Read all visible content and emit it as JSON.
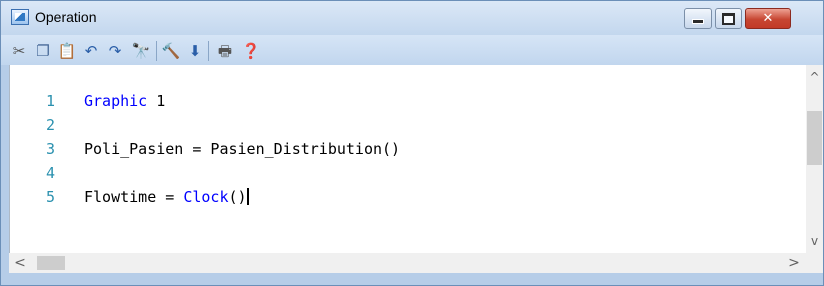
{
  "window": {
    "title": "Operation"
  },
  "title_buttons": {
    "close_glyph": "✕"
  },
  "toolbar": {
    "items": [
      {
        "name": "cut-icon",
        "glyph": "✂",
        "color": "#555555"
      },
      {
        "name": "copy-icon",
        "glyph": "❐",
        "color": "#4a6b99"
      },
      {
        "name": "paste-icon",
        "glyph": "📋",
        "color": "#b8862b"
      },
      {
        "name": "undo-icon",
        "glyph": "↶",
        "color": "#2a5ea8"
      },
      {
        "name": "redo-icon",
        "glyph": "↷",
        "color": "#2a5ea8"
      },
      {
        "name": "find-icon",
        "glyph": "🔭",
        "color": "#333333"
      },
      {
        "name": "build-icon",
        "glyph": "🔨",
        "color": "#6a4a2a"
      },
      {
        "name": "insert-icon",
        "glyph": "⬇",
        "color": "#2a5ea8"
      },
      {
        "name": "print-icon",
        "glyph": "🖶",
        "color": "#555555"
      },
      {
        "name": "help-icon",
        "glyph": "❓",
        "color": "#1f5fae"
      }
    ]
  },
  "editor": {
    "lines": [
      {
        "number": "1",
        "segments": [
          {
            "text": "Graphic",
            "kw": true
          },
          {
            "text": " 1",
            "kw": false
          }
        ]
      },
      {
        "number": "2",
        "segments": []
      },
      {
        "number": "3",
        "segments": [
          {
            "text": "Poli_Pasien = Pasien_Distribution()",
            "kw": false
          }
        ]
      },
      {
        "number": "4",
        "segments": []
      },
      {
        "number": "5",
        "segments": [
          {
            "text": "Flowtime = ",
            "kw": false
          },
          {
            "text": "Clock",
            "kw": true
          },
          {
            "text": "()",
            "kw": false
          }
        ],
        "caret": true
      }
    ]
  },
  "scrollbars": {
    "vertical": {
      "up_glyph": "^",
      "down_glyph": "v"
    },
    "horizontal": {
      "left_glyph": "<",
      "right_glyph": ">"
    }
  },
  "colors": {
    "keyword": "#0000ff",
    "line_number": "#2b91af",
    "titlebar": "#c3d7ee"
  }
}
